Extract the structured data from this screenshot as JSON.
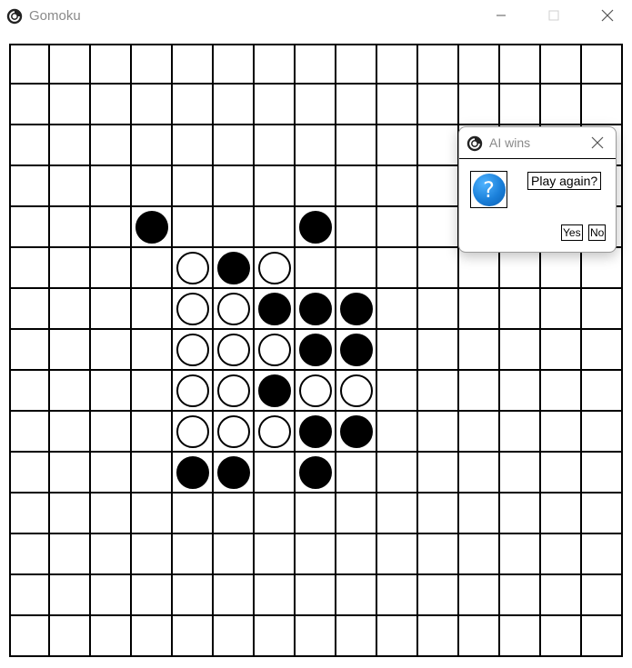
{
  "window": {
    "title": "Gomoku",
    "controls": [
      "minimize",
      "maximize",
      "close"
    ]
  },
  "board": {
    "size": 15,
    "stones": [
      {
        "row": 4,
        "col": 3,
        "color": "black"
      },
      {
        "row": 4,
        "col": 7,
        "color": "black"
      },
      {
        "row": 5,
        "col": 4,
        "color": "white"
      },
      {
        "row": 5,
        "col": 5,
        "color": "black"
      },
      {
        "row": 5,
        "col": 6,
        "color": "white"
      },
      {
        "row": 6,
        "col": 4,
        "color": "white"
      },
      {
        "row": 6,
        "col": 5,
        "color": "white"
      },
      {
        "row": 6,
        "col": 6,
        "color": "black"
      },
      {
        "row": 6,
        "col": 7,
        "color": "black"
      },
      {
        "row": 6,
        "col": 8,
        "color": "black"
      },
      {
        "row": 7,
        "col": 4,
        "color": "white"
      },
      {
        "row": 7,
        "col": 5,
        "color": "white"
      },
      {
        "row": 7,
        "col": 6,
        "color": "white"
      },
      {
        "row": 7,
        "col": 7,
        "color": "black"
      },
      {
        "row": 7,
        "col": 8,
        "color": "black"
      },
      {
        "row": 8,
        "col": 4,
        "color": "white"
      },
      {
        "row": 8,
        "col": 5,
        "color": "white"
      },
      {
        "row": 8,
        "col": 6,
        "color": "black"
      },
      {
        "row": 8,
        "col": 7,
        "color": "white"
      },
      {
        "row": 8,
        "col": 8,
        "color": "white"
      },
      {
        "row": 9,
        "col": 4,
        "color": "white"
      },
      {
        "row": 9,
        "col": 5,
        "color": "white"
      },
      {
        "row": 9,
        "col": 6,
        "color": "white"
      },
      {
        "row": 9,
        "col": 7,
        "color": "black"
      },
      {
        "row": 9,
        "col": 8,
        "color": "black"
      },
      {
        "row": 10,
        "col": 4,
        "color": "black"
      },
      {
        "row": 10,
        "col": 5,
        "color": "black"
      },
      {
        "row": 10,
        "col": 7,
        "color": "black"
      }
    ]
  },
  "dialog": {
    "title": "AI wins",
    "icon": "question-icon",
    "question_glyph": "?",
    "message": "Play again?",
    "yes_label": "Yes",
    "no_label": "No"
  },
  "colors": {
    "title_text": "#8a8a8a",
    "grid": "#000000",
    "question_blue": "#1a7fd9"
  }
}
